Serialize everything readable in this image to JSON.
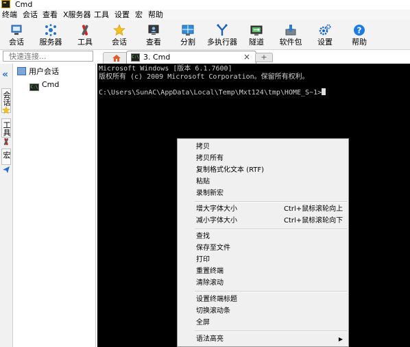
{
  "window": {
    "title": "Cmd"
  },
  "menubar": {
    "items": [
      {
        "label": "终端"
      },
      {
        "label": "会话"
      },
      {
        "label": "查看"
      },
      {
        "label": "X服务器"
      },
      {
        "label": "工具"
      },
      {
        "label": "设置"
      },
      {
        "label": "宏"
      },
      {
        "label": "帮助"
      }
    ]
  },
  "toolbar": {
    "items": [
      {
        "label": "会话",
        "icon": "session-icon"
      },
      {
        "label": "服务器",
        "icon": "servers-icon"
      },
      {
        "label": "工具",
        "icon": "tools-icon"
      },
      {
        "label": "会话",
        "icon": "star-icon"
      },
      {
        "label": "查看",
        "icon": "view-icon"
      },
      {
        "label": "分割",
        "icon": "split-icon"
      },
      {
        "label": "多执行器",
        "icon": "multiexec-icon"
      },
      {
        "label": "隧道",
        "icon": "tunnel-icon"
      },
      {
        "label": "软件包",
        "icon": "package-icon"
      },
      {
        "label": "设置",
        "icon": "gear-icon"
      },
      {
        "label": "帮助",
        "icon": "help-icon"
      }
    ]
  },
  "quick_connect": {
    "placeholder": "快速连接..."
  },
  "sidebar": {
    "tabs": [
      {
        "label": "会话"
      },
      {
        "label": "工具"
      },
      {
        "label": "宏"
      }
    ]
  },
  "session_tree": {
    "root": "用户会话",
    "children": [
      {
        "label": "Cmd"
      }
    ]
  },
  "tabs": {
    "active": {
      "label": "3. Cmd",
      "close": "×",
      "icon_text": "C:\\"
    },
    "new_tab_symbol": "+"
  },
  "terminal": {
    "lines": [
      "Microsoft Windows [版本 6.1.7600]",
      "版权所有 (c) 2009 Microsoft Corporation。保留所有权利。",
      "C:\\Users\\SunAC\\AppData\\Local\\Temp\\Mxt124\\tmp\\HOME_S~1>"
    ]
  },
  "context_menu": {
    "items": [
      {
        "label": "拷贝"
      },
      {
        "label": "拷贝所有"
      },
      {
        "label": "复制格式化文本 (RTF)"
      },
      {
        "label": "粘贴"
      },
      {
        "label": "录制新宏"
      },
      {
        "label": "增大字体大小",
        "shortcut": "Ctrl+鼠标滚轮向上"
      },
      {
        "label": "减小字体大小",
        "shortcut": "Ctrl+鼠标滚轮向下"
      },
      {
        "label": "查找"
      },
      {
        "label": "保存至文件"
      },
      {
        "label": "打印"
      },
      {
        "label": "重置终端"
      },
      {
        "label": "清除滚动"
      },
      {
        "label": "设置终端标题"
      },
      {
        "label": "切换滚动条"
      },
      {
        "label": "全屏"
      },
      {
        "label": "语法高亮",
        "submenu": true
      }
    ]
  },
  "colors": {
    "terminal_bg": "#000000",
    "terminal_fg": "#d0d0d0",
    "accent": "#2a6ecb",
    "menu_bg": "#f0f0f0"
  }
}
